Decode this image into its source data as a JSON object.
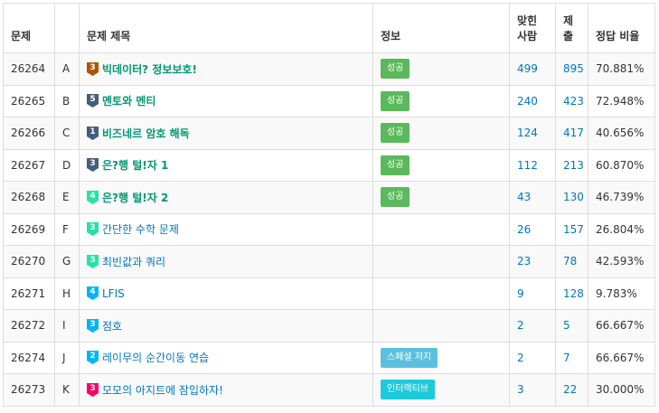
{
  "headers": {
    "problem": "문제",
    "title": "문제 제목",
    "info": "정보",
    "solved_line1": "맞힌",
    "solved_line2": "사람",
    "submit_line1": "제",
    "submit_line2": "출",
    "ratio": "정답 비율"
  },
  "colors": {
    "bronze": "#ad5600",
    "silver": "#435f7a",
    "gold": "#ec9a00",
    "platinum": "#27e2a4",
    "diamond": "#00b4fc",
    "ruby": "#ff0062",
    "success_badge": "#5cb85c",
    "special_badge": "#5bc0de",
    "interactive_badge": "#1ccbd9"
  },
  "rows": [
    {
      "id": "26264",
      "letter": "A",
      "tier": "bronze",
      "tier_level": "3",
      "tier_icon": "bronze-3-icon",
      "title": "빅데이터? 정보보호!",
      "solved_state": true,
      "badge": "성공",
      "badge_type": "success",
      "solved": "499",
      "submits": "895",
      "ratio": "70.881%"
    },
    {
      "id": "26265",
      "letter": "B",
      "tier": "silver",
      "tier_level": "5",
      "tier_icon": "silver-5-icon",
      "title": "멘토와 멘티",
      "solved_state": true,
      "badge": "성공",
      "badge_type": "success",
      "solved": "240",
      "submits": "423",
      "ratio": "72.948%"
    },
    {
      "id": "26266",
      "letter": "C",
      "tier": "silver",
      "tier_level": "1",
      "tier_icon": "silver-1-icon",
      "title": "비즈네르 암호 해독",
      "solved_state": true,
      "badge": "성공",
      "badge_type": "success",
      "solved": "124",
      "submits": "417",
      "ratio": "40.656%"
    },
    {
      "id": "26267",
      "letter": "D",
      "tier": "silver",
      "tier_level": "3",
      "tier_icon": "silver-3-icon",
      "title": "은?행 털!자 1",
      "solved_state": true,
      "badge": "성공",
      "badge_type": "success",
      "solved": "112",
      "submits": "213",
      "ratio": "60.870%"
    },
    {
      "id": "26268",
      "letter": "E",
      "tier": "platinum",
      "tier_level": "4",
      "tier_icon": "platinum-4-icon",
      "title": "은?행 털!자 2",
      "solved_state": true,
      "badge": "성공",
      "badge_type": "success",
      "solved": "43",
      "submits": "130",
      "ratio": "46.739%"
    },
    {
      "id": "26269",
      "letter": "F",
      "tier": "platinum",
      "tier_level": "3",
      "tier_icon": "platinum-3-icon",
      "title": "간단한 수학 문제",
      "solved_state": false,
      "badge": "",
      "badge_type": "",
      "solved": "26",
      "submits": "157",
      "ratio": "26.804%"
    },
    {
      "id": "26270",
      "letter": "G",
      "tier": "platinum",
      "tier_level": "3",
      "tier_icon": "platinum-3-icon",
      "title": "최빈값과 쿼리",
      "solved_state": false,
      "badge": "",
      "badge_type": "",
      "solved": "23",
      "submits": "78",
      "ratio": "42.593%"
    },
    {
      "id": "26271",
      "letter": "H",
      "tier": "diamond",
      "tier_level": "4",
      "tier_icon": "diamond-4-icon",
      "title": "LFIS",
      "solved_state": false,
      "badge": "",
      "badge_type": "",
      "solved": "9",
      "submits": "128",
      "ratio": "9.783%"
    },
    {
      "id": "26272",
      "letter": "I",
      "tier": "diamond",
      "tier_level": "3",
      "tier_icon": "diamond-3-icon",
      "title": "점호",
      "solved_state": false,
      "badge": "",
      "badge_type": "",
      "solved": "2",
      "submits": "5",
      "ratio": "66.667%"
    },
    {
      "id": "26274",
      "letter": "J",
      "tier": "diamond",
      "tier_level": "2",
      "tier_icon": "diamond-2-icon",
      "title": "레이무의 순간이동 연습",
      "solved_state": false,
      "badge": "스페셜 저지",
      "badge_type": "special",
      "solved": "2",
      "submits": "7",
      "ratio": "66.667%"
    },
    {
      "id": "26273",
      "letter": "K",
      "tier": "ruby",
      "tier_level": "3",
      "tier_icon": "ruby-3-icon",
      "title": "모모의 아지트에 잠입하자!",
      "solved_state": false,
      "badge": "인터랙티브",
      "badge_type": "interactive",
      "solved": "3",
      "submits": "22",
      "ratio": "30.000%"
    }
  ]
}
